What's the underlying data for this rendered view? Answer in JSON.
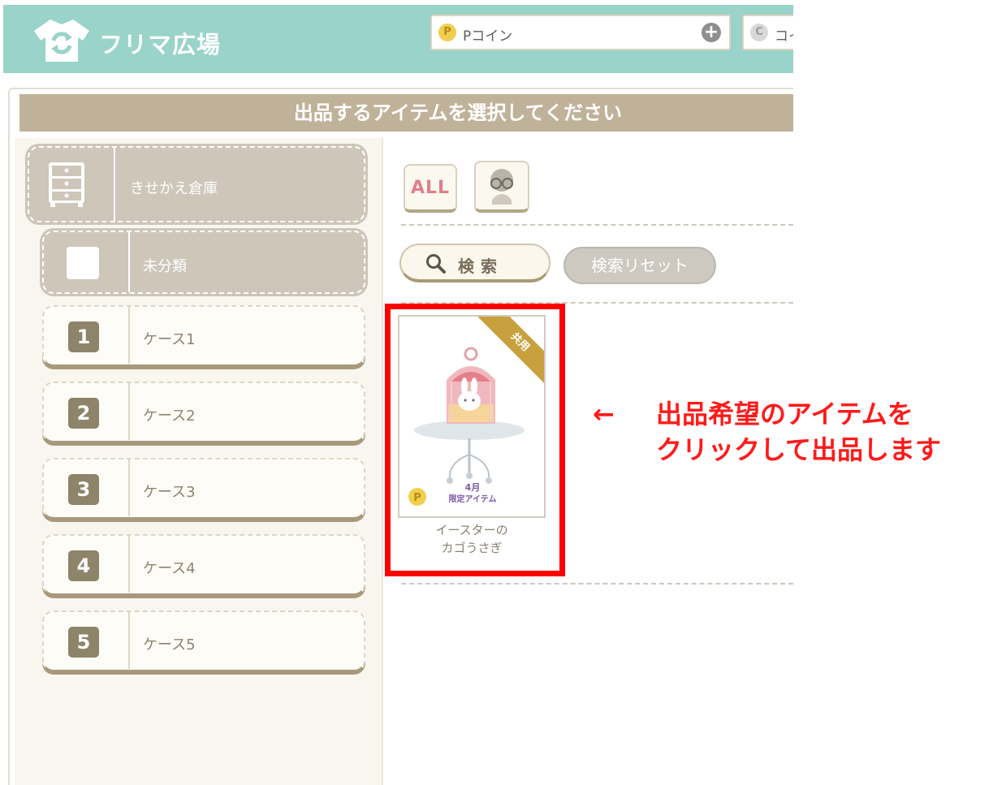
{
  "header": {
    "app_title": "フリマ広場",
    "pcoin_label": "Pコイン",
    "pcoin_icon": "P",
    "ccoin_label": "コイ",
    "ccoin_icon": "C"
  },
  "title_bar": "出品するアイテムを選択してください",
  "sidebar": {
    "warehouse_label": "きせかえ倉庫",
    "uncategorized_label": "未分類",
    "cases": [
      {
        "num": "1",
        "label": "ケース1"
      },
      {
        "num": "2",
        "label": "ケース2"
      },
      {
        "num": "3",
        "label": "ケース3"
      },
      {
        "num": "4",
        "label": "ケース4"
      },
      {
        "num": "5",
        "label": "ケース5"
      }
    ]
  },
  "filters": {
    "all_label": "ALL"
  },
  "search": {
    "search_label": "検索",
    "reset_label": "検索リセット"
  },
  "item": {
    "badge": "共用",
    "month_label": "4月",
    "limited_label": "限定アイテム",
    "name_line1": "イースターの",
    "name_line2": "カゴうさぎ",
    "coin": "P"
  },
  "annotation": {
    "arrow": "←",
    "line1": "出品希望のアイテムを",
    "line2": "クリックして出品します"
  },
  "colors": {
    "header": "#99d3c9",
    "title_bar": "#c0b199",
    "highlight": "#ff0000",
    "annotation": "#ff1a1a"
  }
}
